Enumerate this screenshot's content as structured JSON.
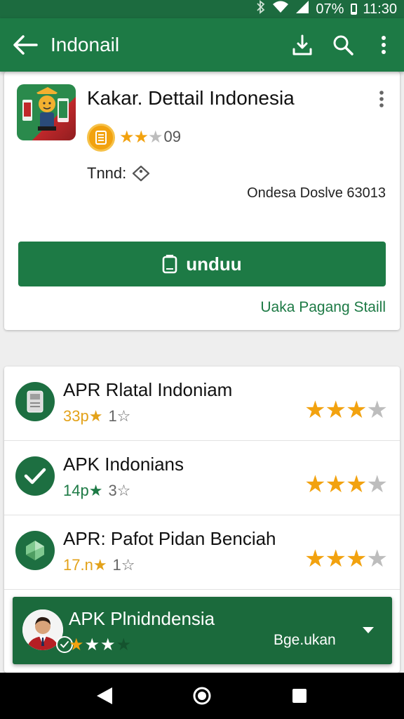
{
  "status_bar": {
    "battery": "07%",
    "time": "11:30"
  },
  "app_bar": {
    "title": "Indonail"
  },
  "app_card": {
    "title": "Kakar. Dettail Indonesia",
    "rating_stars": 2,
    "rating_count": "09",
    "tag_label": "Tnnd:",
    "developer_line": "Ondesa Doslve 63013",
    "install_label": "unduu",
    "link_label": "Uaka Pagang Staill"
  },
  "list": [
    {
      "title": "APR Rlatal Indoniam",
      "meta_a": "33p★",
      "meta_b": "1☆",
      "meta_color": "#e3a21a",
      "stars": 3,
      "icon": "phone-device-icon"
    },
    {
      "title": "APK Indonians",
      "meta_a": "14p★",
      "meta_b": "3☆",
      "meta_color": "#1d7a45",
      "stars": 3,
      "icon": "check-icon"
    },
    {
      "title": "APR: Pafot Pidan Benciah",
      "meta_a": "17.n★",
      "meta_b": "1☆",
      "meta_color": "#e3a21a",
      "stars": 3,
      "icon": "gem-icon"
    }
  ],
  "banner": {
    "title": "APK Plnidndensia",
    "stars": 3,
    "action_label": "Bge.ukan"
  },
  "colors": {
    "primary": "#1d7a45",
    "primary_dark": "#1c6b3f",
    "star": "#f2a20f",
    "star_empty": "#bdbdbd"
  }
}
